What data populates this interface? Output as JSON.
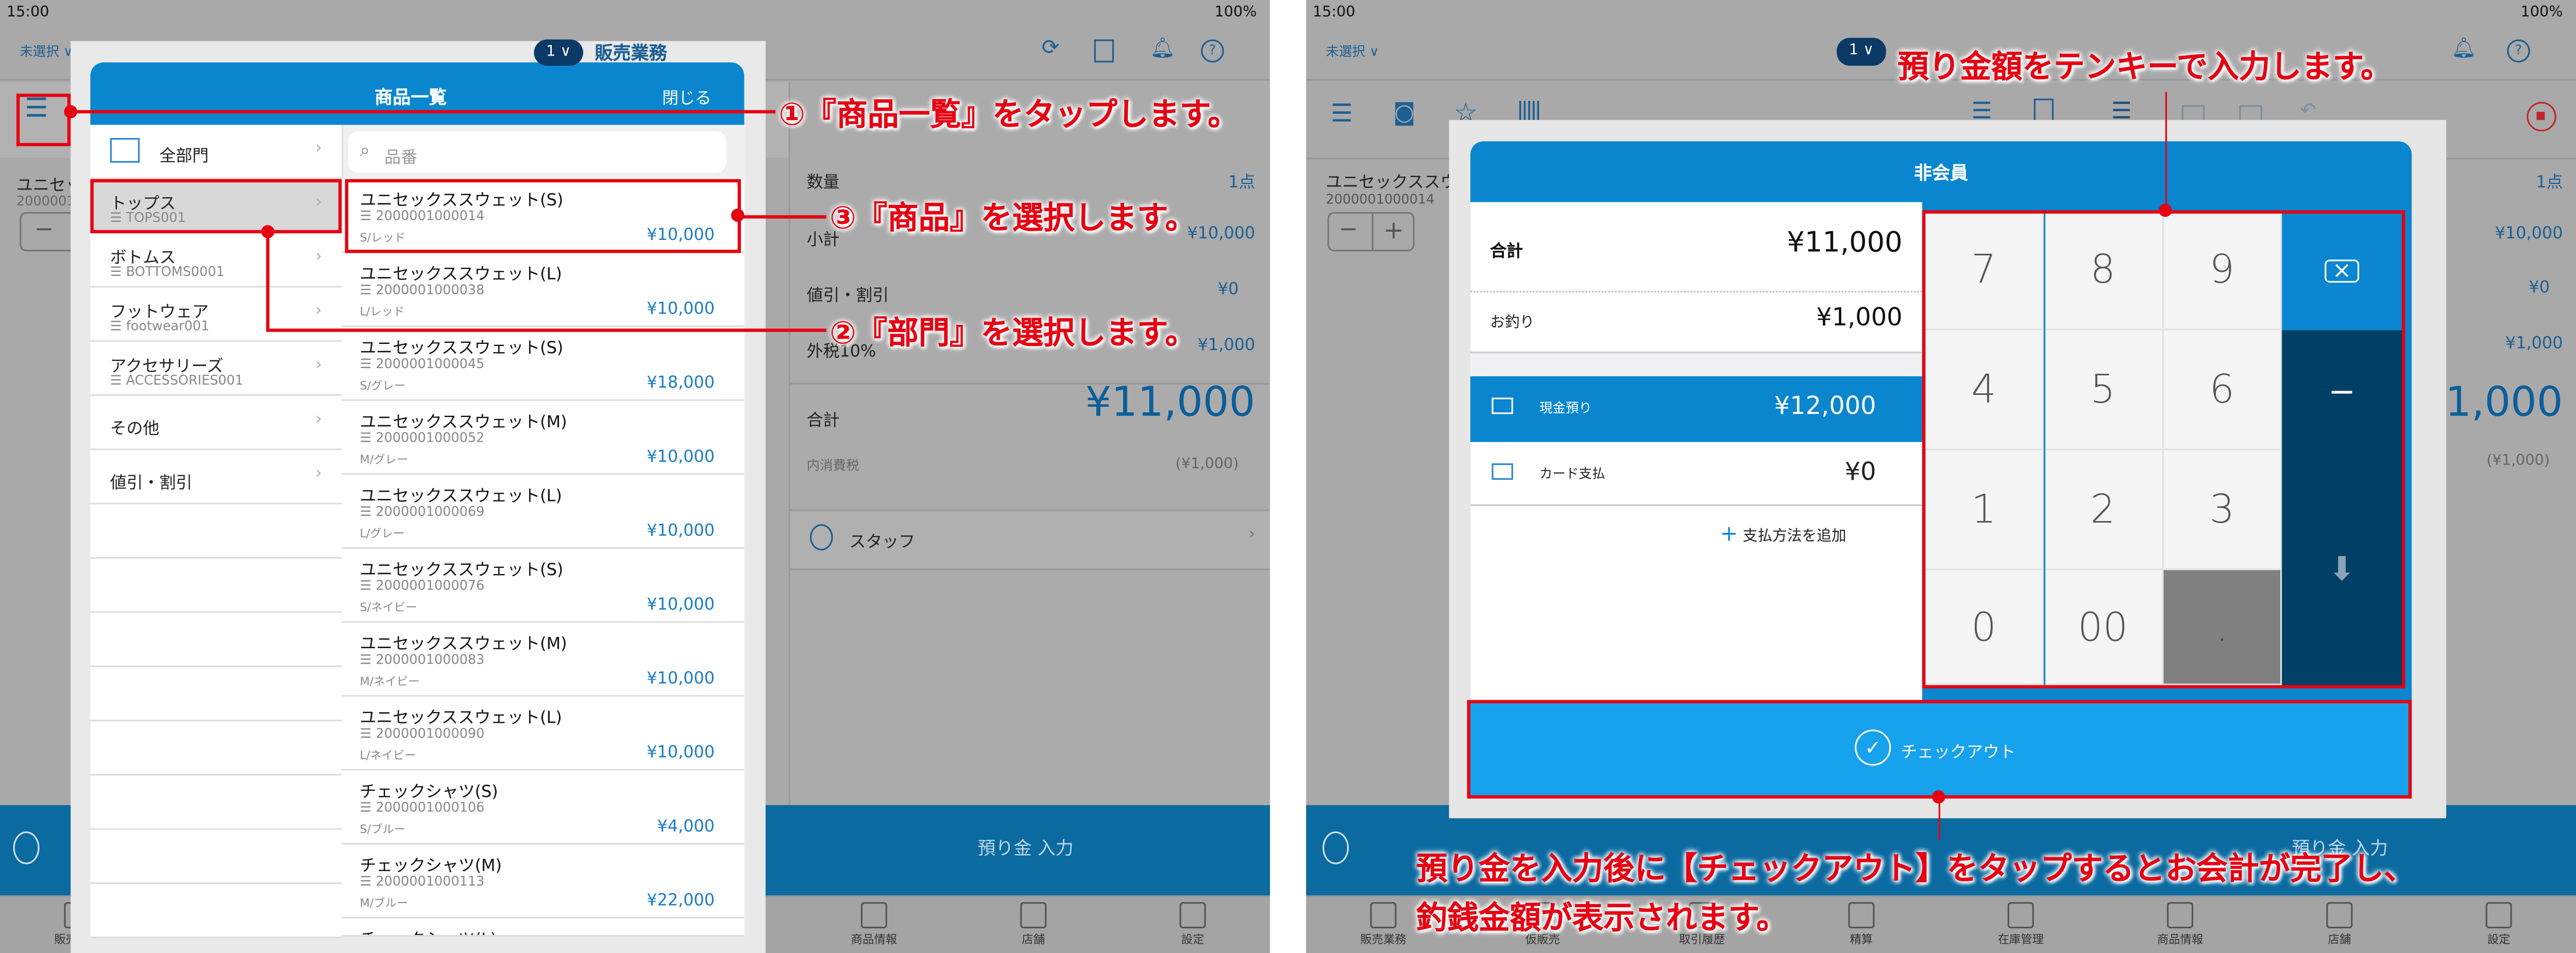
{
  "status_bar": {
    "time": "15:00",
    "battery": "100%"
  },
  "header": {
    "customer_select": "未選択",
    "register_number": "1",
    "mode_title": "販売業務"
  },
  "cart": {
    "item_name": "ユニセックススウ",
    "item_code": "2000001000014",
    "stepper_minus": "−",
    "stepper_plus": "+"
  },
  "summary": {
    "quantity_label": "数量",
    "quantity_value": "1点",
    "subtotal_label": "小計",
    "subtotal_value": "¥10,000",
    "discount_label": "値引・割引",
    "discount_value": "¥0",
    "tax_label": "外税10%",
    "tax_value": "¥1,000",
    "total_label": "合計",
    "total_value": "¥11,000",
    "inner_tax_label": "内消費税",
    "inner_tax_value": "(¥1,000)",
    "staff_label": "スタッフ"
  },
  "deposit_bar": {
    "label": "預り金 入力"
  },
  "tabs": [
    "販売業務",
    "仮販売",
    "取引履歴",
    "精算",
    "在庫管理",
    "商品情報",
    "店舗",
    "設定"
  ],
  "product_modal": {
    "title": "商品一覧",
    "close": "閉じる",
    "search_placeholder": "品番",
    "categories": [
      {
        "name": "全部門",
        "code": "",
        "icon": "folder-icon"
      },
      {
        "name": "トップス",
        "code": "☰ TOPS001",
        "selected": true
      },
      {
        "name": "ボトムス",
        "code": "☰ BOTTOMS0001"
      },
      {
        "name": "フットウェア",
        "code": "☰ footwear001"
      },
      {
        "name": "アクセサリーズ",
        "code": "☰ ACCESSORIES001"
      },
      {
        "name": "その他",
        "code": ""
      },
      {
        "name": "値引・割引",
        "code": ""
      }
    ],
    "products": [
      {
        "name": "ユニセックススウェット(S)",
        "code": "☰ 2000001000014",
        "variant": "S/レッド",
        "price": "¥10,000"
      },
      {
        "name": "ユニセックススウェット(L)",
        "code": "☰ 2000001000038",
        "variant": "L/レッド",
        "price": "¥10,000"
      },
      {
        "name": "ユニセックススウェット(S)",
        "code": "☰ 2000001000045",
        "variant": "S/グレー",
        "price": "¥18,000"
      },
      {
        "name": "ユニセックススウェット(M)",
        "code": "☰ 2000001000052",
        "variant": "M/グレー",
        "price": "¥10,000"
      },
      {
        "name": "ユニセックススウェット(L)",
        "code": "☰ 2000001000069",
        "variant": "L/グレー",
        "price": "¥10,000"
      },
      {
        "name": "ユニセックススウェット(S)",
        "code": "☰ 2000001000076",
        "variant": "S/ネイビー",
        "price": "¥10,000"
      },
      {
        "name": "ユニセックススウェット(M)",
        "code": "☰ 2000001000083",
        "variant": "M/ネイビー",
        "price": "¥10,000"
      },
      {
        "name": "ユニセックススウェット(L)",
        "code": "☰ 2000001000090",
        "variant": "L/ネイビー",
        "price": "¥10,000"
      },
      {
        "name": "チェックシャツ(S)",
        "code": "☰ 2000001000106",
        "variant": "S/ブルー",
        "price": "¥4,000"
      },
      {
        "name": "チェックシャツ(M)",
        "code": "☰ 2000001000113",
        "variant": "M/ブルー",
        "price": "¥22,000"
      },
      {
        "name": "チェックシャツ(L)",
        "code": "",
        "variant": "",
        "price": ""
      }
    ]
  },
  "payment_modal": {
    "title": "非会員",
    "total_label": "合計",
    "total_value": "¥11,000",
    "change_label": "お釣り",
    "change_value": "¥1,000",
    "methods": [
      {
        "label": "現金預り",
        "value": "¥12,000",
        "icon": "cash-icon",
        "active": true
      },
      {
        "label": "カード支払",
        "value": "¥0",
        "icon": "card-icon"
      }
    ],
    "add_method": "支払方法を追加",
    "keys": [
      "7",
      "8",
      "9",
      "4",
      "5",
      "6",
      "1",
      "2",
      "3",
      "0",
      "00",
      "."
    ],
    "minus_key": "−",
    "checkout": "チェックアウト"
  },
  "annotations": {
    "step1": "①『商品一覧』をタップします。",
    "step2": "②『部門』を選択します。",
    "step3": "③『商品』を選択します。",
    "tenkey": "預り金額をテンキーで入力します。",
    "checkout_line1": "預り金を入力後に【チェックアウト】をタップするとお会計が完了し、",
    "checkout_line2": "釣銭金額が表示されます。"
  },
  "colors": {
    "brand_blue": "#0a86cf",
    "checkout_blue": "#17a2ee",
    "navy": "#003f66",
    "annotation_red": "#e60012"
  }
}
